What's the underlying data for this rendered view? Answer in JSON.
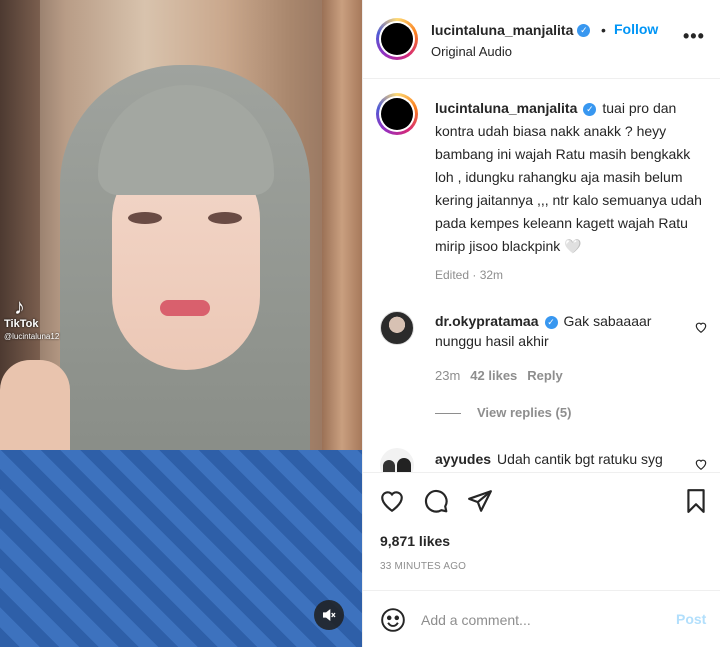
{
  "media": {
    "watermark_brand": "TikTok",
    "watermark_handle": "@lucintaluna12",
    "mute_icon": "speaker-muted-icon"
  },
  "header": {
    "username": "lucintaluna_manjalita",
    "separator": "•",
    "follow_label": "Follow",
    "audio_label": "Original Audio",
    "more_icon": "more-options-icon"
  },
  "caption": {
    "username": "lucintaluna_manjalita",
    "text": "tuai pro dan kontra udah biasa nakk anakk ? heyy bambang ini wajah Ratu masih bengkakk loh , idungku rahangku aja masih belum kering jaitannya ,,, ntr kalo semuanya udah pada kempes keleann kagett wajah Ratu mirip jisoo blackpink 🤍",
    "meta": "Edited · 32m"
  },
  "comments": [
    {
      "username": "dr.okypratamaa",
      "text": "Gak sabaaaar nunggu hasil akhir",
      "time": "23m",
      "likes": "42 likes",
      "reply_label": "Reply",
      "view_replies": "View replies (5)"
    },
    {
      "username": "ayyudes",
      "text": "Udah cantik bgt ratuku syg"
    }
  ],
  "actions": {
    "likes": "9,871 likes",
    "time_ago": "33 MINUTES AGO"
  },
  "add_comment": {
    "placeholder": "Add a comment...",
    "post_label": "Post"
  },
  "colors": {
    "accent": "#0095f6",
    "verified": "#3897f0",
    "muted_text": "#8e8e8e",
    "post_disabled": "#b2dffc"
  }
}
